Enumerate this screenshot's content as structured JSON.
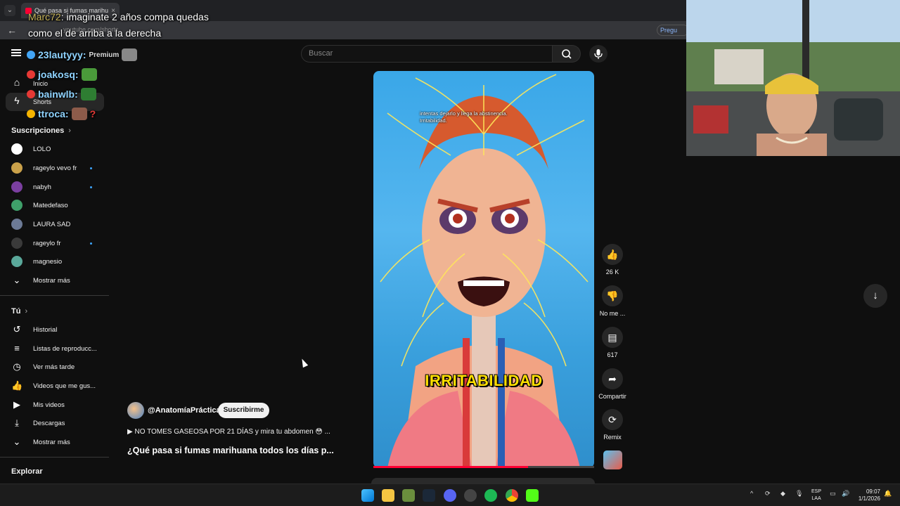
{
  "browser": {
    "tab_title": "Qué pasa si fumas marihu",
    "address_text": "youtube.com/shorts",
    "ask_button": "Pregu"
  },
  "stream_overlay": {
    "message_user": "Marc72",
    "message_line1": "imaginate 2 años compa quedas",
    "message_line2": "como el de arriba a la derecha",
    "chat": [
      {
        "user": "23lautyyy:",
        "text": "Premium"
      },
      {
        "user": "joakosq:",
        "text": ""
      },
      {
        "user": "bainwlb:",
        "text": ""
      },
      {
        "user": "ttroca:",
        "text": "?"
      }
    ]
  },
  "sidebar": {
    "mini": [
      {
        "label": "Inicio",
        "icon": "home-icon"
      },
      {
        "label": "Shorts",
        "icon": "shorts-icon"
      }
    ],
    "subscriptions_title": "Suscripciones",
    "subscriptions": [
      {
        "name": "LOLO",
        "color": "#ffffff",
        "new": false
      },
      {
        "name": "rageylo vevo fr",
        "color": "#caa14a",
        "new": true
      },
      {
        "name": "nabyh",
        "color": "#7b3fa0",
        "new": true
      },
      {
        "name": "Matedefaso",
        "color": "#3fa06a",
        "new": false
      },
      {
        "name": "LAURA SAD",
        "color": "#6c7a96",
        "new": false
      },
      {
        "name": "rageylo fr",
        "color": "#3a3a3a",
        "new": true
      },
      {
        "name": "magnesio",
        "color": "#5aa89a",
        "new": false
      }
    ],
    "show_more_1": "Mostrar más",
    "you_title": "Tú",
    "you_items": [
      {
        "label": "Historial",
        "icon": "history-icon"
      },
      {
        "label": "Listas de reproducc...",
        "icon": "playlist-icon"
      },
      {
        "label": "Ver más tarde",
        "icon": "watch-later-icon"
      },
      {
        "label": "Videos que me gus...",
        "icon": "like-icon"
      },
      {
        "label": "Mis videos",
        "icon": "my-videos-icon"
      },
      {
        "label": "Descargas",
        "icon": "download-icon"
      }
    ],
    "show_more_2": "Mostrar más",
    "explore_title": "Explorar"
  },
  "search": {
    "placeholder": "Buscar"
  },
  "short": {
    "caption": [
      "intentas dejarlo y llega la abstinencia.",
      "Irritabilidad."
    ],
    "overlay_title": "IRRITABILIDAD",
    "progress": 0.7,
    "channel": "@AnatomíaPráctica",
    "subscribe": "Suscribirme",
    "promo": "NO TOMES GASEOSA POR 21 DÍAS y mira tu abdomen 😳 ...",
    "title": "¿Qué pasa si fumas marihuana todos los días p..."
  },
  "actions": {
    "likes": "26 K",
    "dislike": "No me ...",
    "comments": "617",
    "share": "Compartir",
    "remix": "Remix"
  },
  "taskbar": {
    "lang_line1": "ESP",
    "lang_line2": "LAA",
    "time": "09:07",
    "date": "1/1/2026"
  },
  "colors": {
    "background": "#0f0f0f",
    "accent_red": "#ff0033",
    "caption_yellow": "#ffe000"
  }
}
